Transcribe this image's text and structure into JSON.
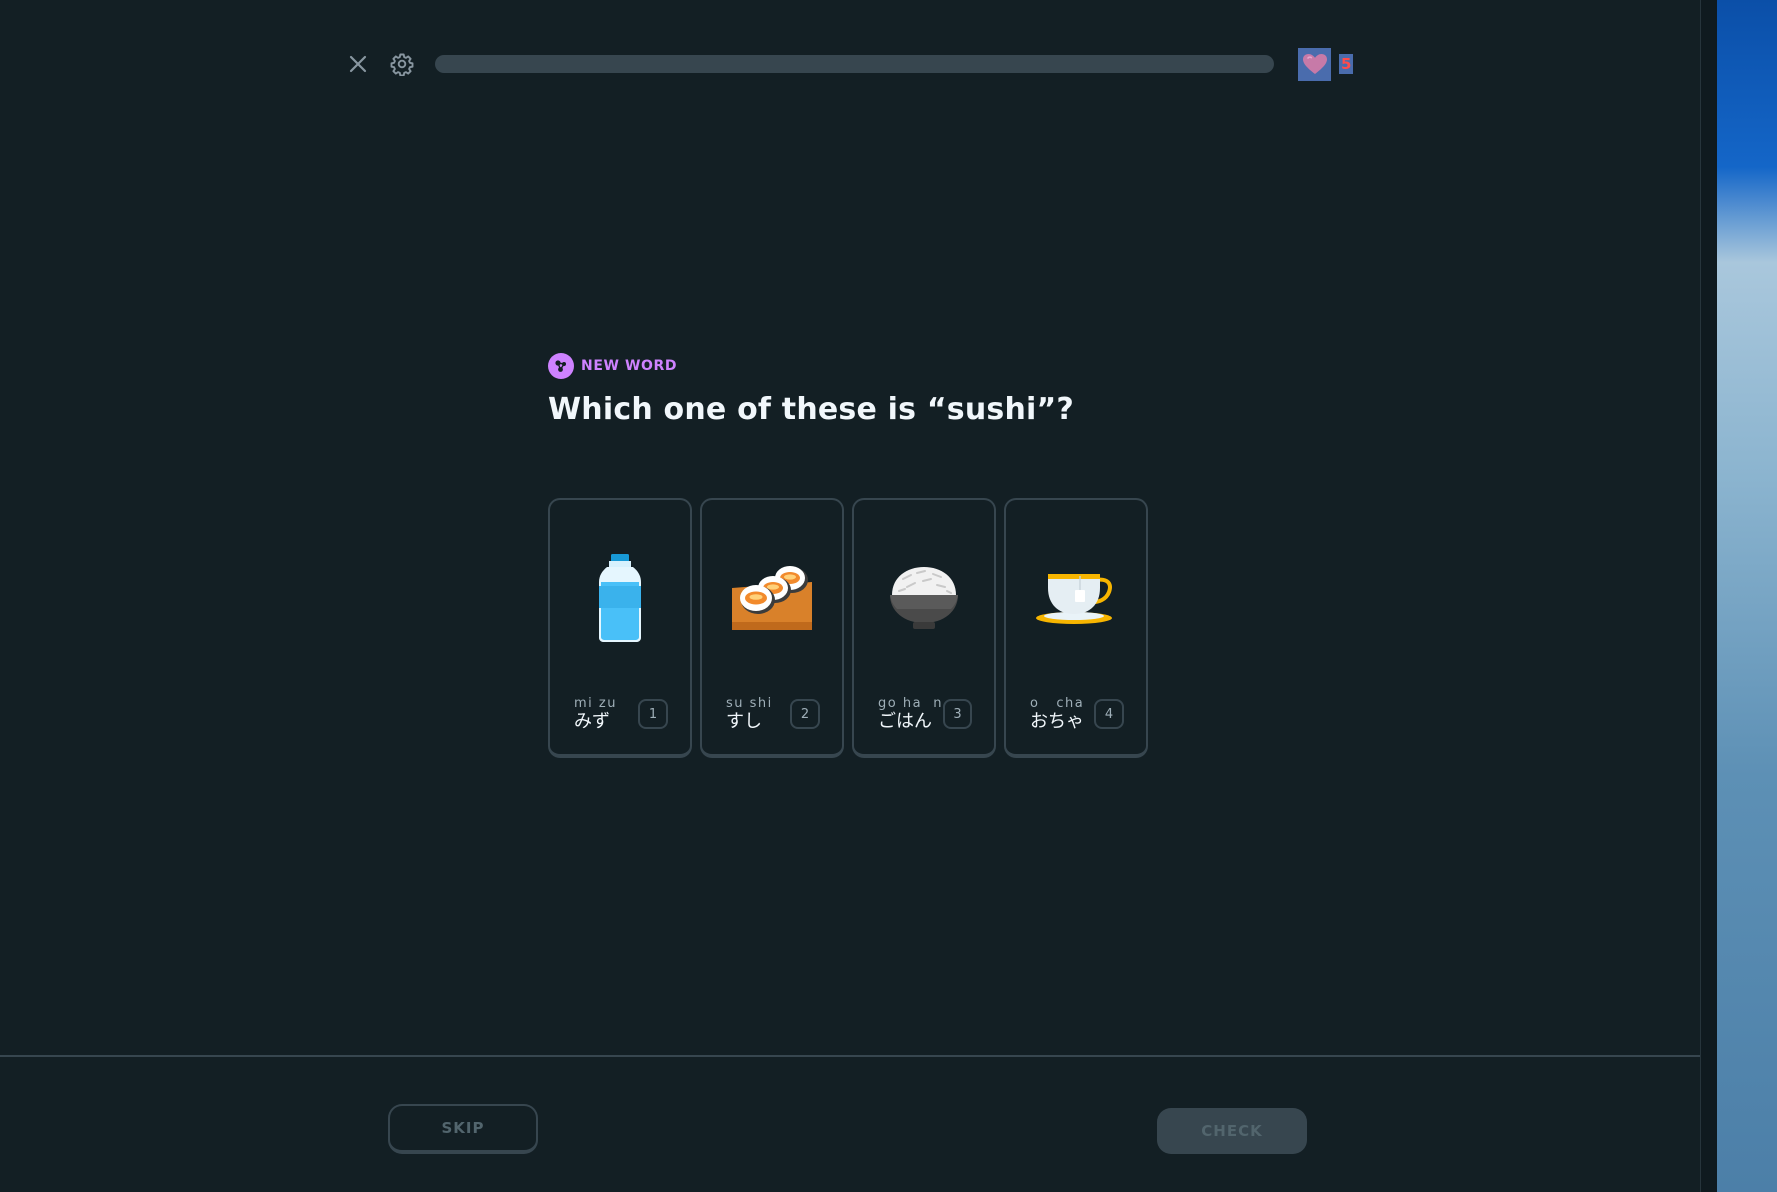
{
  "header": {
    "close_icon": "close-icon",
    "settings_icon": "gear-icon",
    "progress": 0,
    "hearts_icon": "heart-icon",
    "hearts_count": "5"
  },
  "challenge": {
    "badge_icon": "new-word-icon",
    "badge": "NEW WORD",
    "prompt": "Which one of these is “sushi”?"
  },
  "choices": [
    {
      "romaji": "mi zu",
      "kana": "みず",
      "key": "1",
      "image": "water-bottle"
    },
    {
      "romaji": "su shi",
      "kana": "すし",
      "key": "2",
      "image": "sushi-rolls"
    },
    {
      "romaji": "go ha  n",
      "kana": "ごはん",
      "key": "3",
      "image": "rice-bowl"
    },
    {
      "romaji": "o   cha",
      "kana": "おちゃ",
      "key": "4",
      "image": "tea-cup"
    }
  ],
  "footer": {
    "skip": "SKIP",
    "check": "CHECK"
  },
  "colors": {
    "background": "#131f24",
    "border": "#37464f",
    "accent_purple": "#ce82ff",
    "text": "#f1f7fb"
  }
}
